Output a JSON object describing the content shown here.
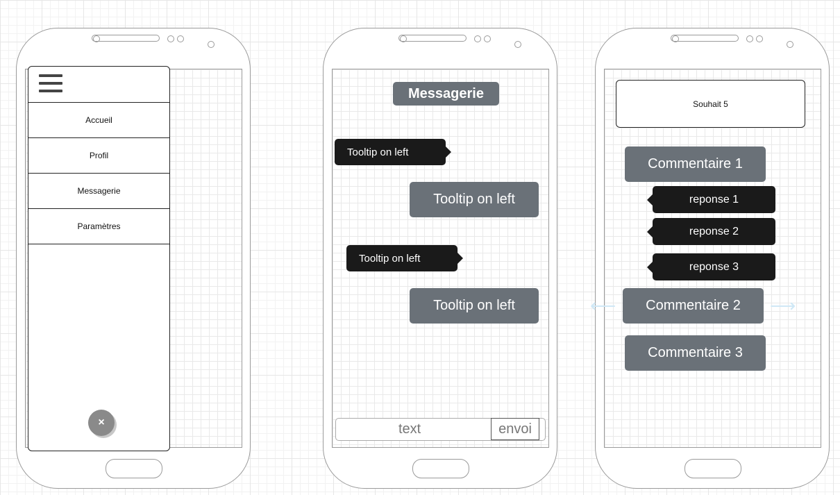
{
  "menu_phone": {
    "items": [
      {
        "label": "Accueil"
      },
      {
        "label": "Profil"
      },
      {
        "label": "Messagerie"
      },
      {
        "label": "Paramètres"
      }
    ],
    "close_symbol": "×"
  },
  "chat_phone": {
    "title": "Messagerie",
    "messages": [
      {
        "text": "Tooltip on left",
        "style": "dark"
      },
      {
        "text": "Tooltip on left",
        "style": "gray"
      },
      {
        "text": "Tooltip on left",
        "style": "dark"
      },
      {
        "text": "Tooltip on left",
        "style": "gray"
      }
    ],
    "input_text": "text",
    "send_label": "envoi"
  },
  "comments_phone": {
    "wish": "Souhait 5",
    "comments": [
      {
        "label": "Commentaire 1"
      },
      {
        "label": "Commentaire 2"
      },
      {
        "label": "Commentaire 3"
      }
    ],
    "replies": [
      {
        "label": "reponse 1"
      },
      {
        "label": "reponse 2"
      },
      {
        "label": "reponse 3"
      }
    ]
  },
  "colors": {
    "dark_tooltip": "#1a1a1a",
    "gray_box": "#6a7178",
    "arrow": "#cfe8f6"
  },
  "icons": [
    "hamburger-icon",
    "close-icon",
    "arrow-left-icon",
    "arrow-right-icon"
  ]
}
